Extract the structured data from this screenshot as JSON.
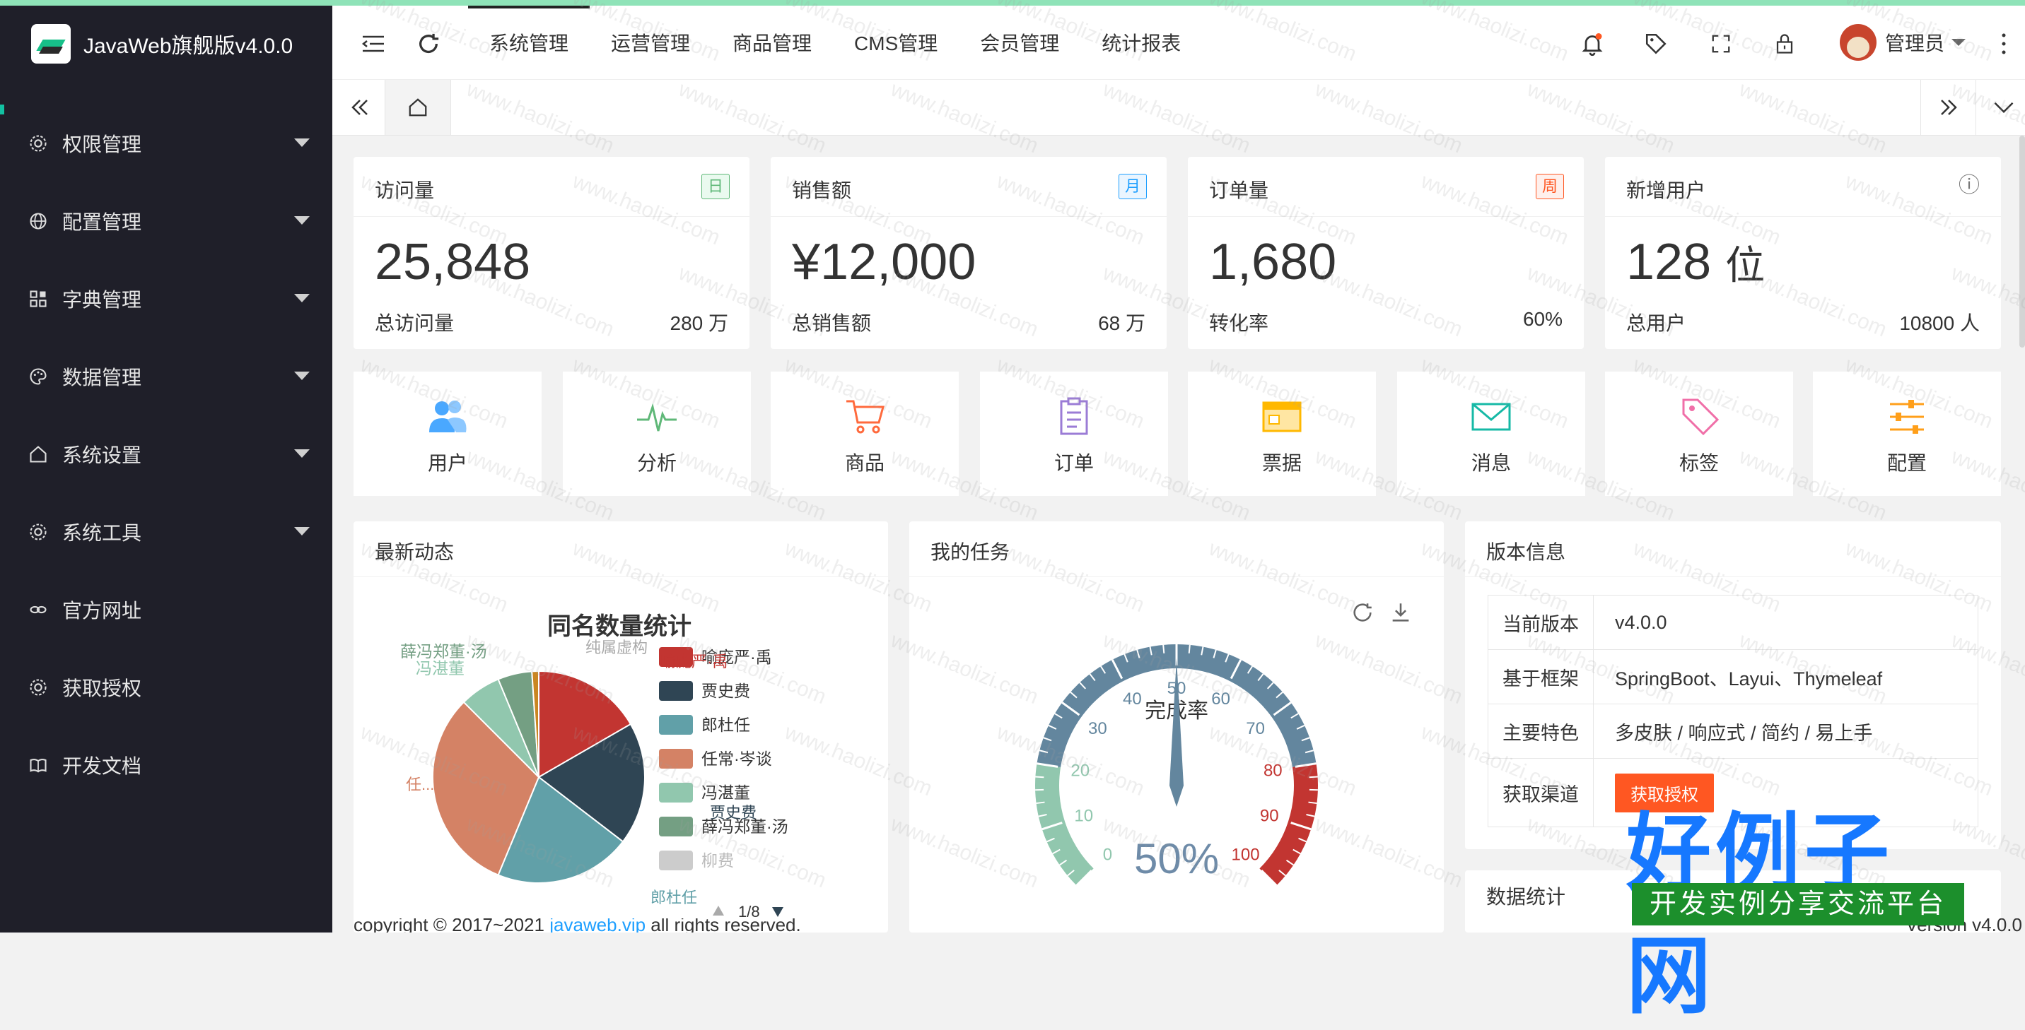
{
  "app": {
    "title": "JavaWeb旗舰版v4.0.0"
  },
  "sidebar": {
    "items": [
      {
        "label": "权限管理",
        "icon": "gear-icon",
        "expandable": true
      },
      {
        "label": "配置管理",
        "icon": "globe-icon",
        "expandable": true
      },
      {
        "label": "字典管理",
        "icon": "app-grid-icon",
        "expandable": true
      },
      {
        "label": "数据管理",
        "icon": "palette-icon",
        "expandable": true
      },
      {
        "label": "系统设置",
        "icon": "home-icon",
        "expandable": true
      },
      {
        "label": "系统工具",
        "icon": "gear-icon",
        "expandable": true
      },
      {
        "label": "官方网址",
        "icon": "link-icon",
        "expandable": false
      },
      {
        "label": "获取授权",
        "icon": "gear-icon",
        "expandable": false
      },
      {
        "label": "开发文档",
        "icon": "book-icon",
        "expandable": false
      }
    ]
  },
  "header": {
    "nav": [
      "系统管理",
      "运营管理",
      "商品管理",
      "CMS管理",
      "会员管理",
      "统计报表"
    ],
    "active_nav": "系统管理",
    "user": "管理员"
  },
  "stats": [
    {
      "title": "访问量",
      "badge": "日",
      "badge_color": "#5fb878",
      "value": "25,848",
      "foot_label": "总访问量",
      "foot_value": "280 万"
    },
    {
      "title": "销售额",
      "badge": "月",
      "badge_color": "#1e9fff",
      "value": "¥12,000",
      "foot_label": "总销售额",
      "foot_value": "68 万"
    },
    {
      "title": "订单量",
      "badge": "周",
      "badge_color": "#ff5722",
      "value": "1,680",
      "foot_label": "转化率",
      "foot_value": "60%"
    },
    {
      "title": "新增用户",
      "badge": "ⓘ",
      "badge_color": "#999999",
      "value": "128",
      "value_unit": "位",
      "foot_label": "总用户",
      "foot_value": "10800 人"
    }
  ],
  "quick_links": [
    {
      "label": "用户",
      "icon": "users-icon",
      "color": "#1e9fff"
    },
    {
      "label": "分析",
      "icon": "analytics-icon",
      "color": "#5fb878"
    },
    {
      "label": "商品",
      "icon": "cart-icon",
      "color": "#ff5722"
    },
    {
      "label": "订单",
      "icon": "order-icon",
      "color": "#9b7cd6"
    },
    {
      "label": "票据",
      "icon": "ticket-icon",
      "color": "#ffb800"
    },
    {
      "label": "消息",
      "icon": "mail-icon",
      "color": "#16b9a6"
    },
    {
      "label": "标签",
      "icon": "tag-icon",
      "color": "#f06fa8"
    },
    {
      "label": "配置",
      "icon": "sliders-icon",
      "color": "#ff9f1a"
    }
  ],
  "panels": {
    "news": "最新动态",
    "tasks": "我的任务",
    "version": "版本信息",
    "data_stats": "数据统计"
  },
  "version_info": {
    "rows": [
      {
        "key": "当前版本",
        "value": "v4.0.0"
      },
      {
        "key": "基于框架",
        "value": "SpringBoot、Layui、Thymeleaf"
      },
      {
        "key": "主要特色",
        "value": "多皮肤 / 响应式 / 简约 / 易上手"
      },
      {
        "key": "获取渠道",
        "button": "获取授权"
      }
    ]
  },
  "pie_chart": {
    "title": "同名数量统计",
    "legend": [
      "喻庞严·禹",
      "贾史费",
      "郎杜任",
      "任常·岑谈",
      "冯湛董",
      "薛冯郑董·汤",
      "柳费"
    ],
    "legend_page": "1/8",
    "outer_labels": [
      "薛冯郑董·汤",
      "冯湛董",
      "纯属虚构",
      "喻庞严·禹",
      "贾史费",
      "任...",
      "郎杜任"
    ]
  },
  "chart_data": [
    {
      "type": "pie",
      "title": "同名数量统计",
      "categories": [
        "喻庞严·禹",
        "贾史费",
        "郎杜任",
        "任常·岑谈",
        "冯湛董",
        "薛冯郑董·汤",
        "柳费"
      ],
      "values": [
        16,
        18,
        20,
        30,
        6,
        5,
        1
      ],
      "colors": [
        "#c23531",
        "#2f4554",
        "#61a0a8",
        "#d48265",
        "#91c7ae",
        "#749f83",
        "#ca8622"
      ]
    },
    {
      "type": "gauge",
      "title": "完成率",
      "value": 50,
      "min": 0,
      "max": 100,
      "ticks": [
        "0",
        "10",
        "20",
        "30",
        "40",
        "50",
        "60",
        "70",
        "80",
        "90",
        "100"
      ],
      "display": "50%"
    }
  ],
  "footer": {
    "copyright": "copyright © 2017~2021",
    "link": "javaweb.vip",
    "rights": "all rights reserved.",
    "version": "Version v4.0.0"
  },
  "watermark": "www.haolizi.com",
  "brand": {
    "title": "好例子网",
    "subtitle": "开发实例分享交流平台"
  }
}
